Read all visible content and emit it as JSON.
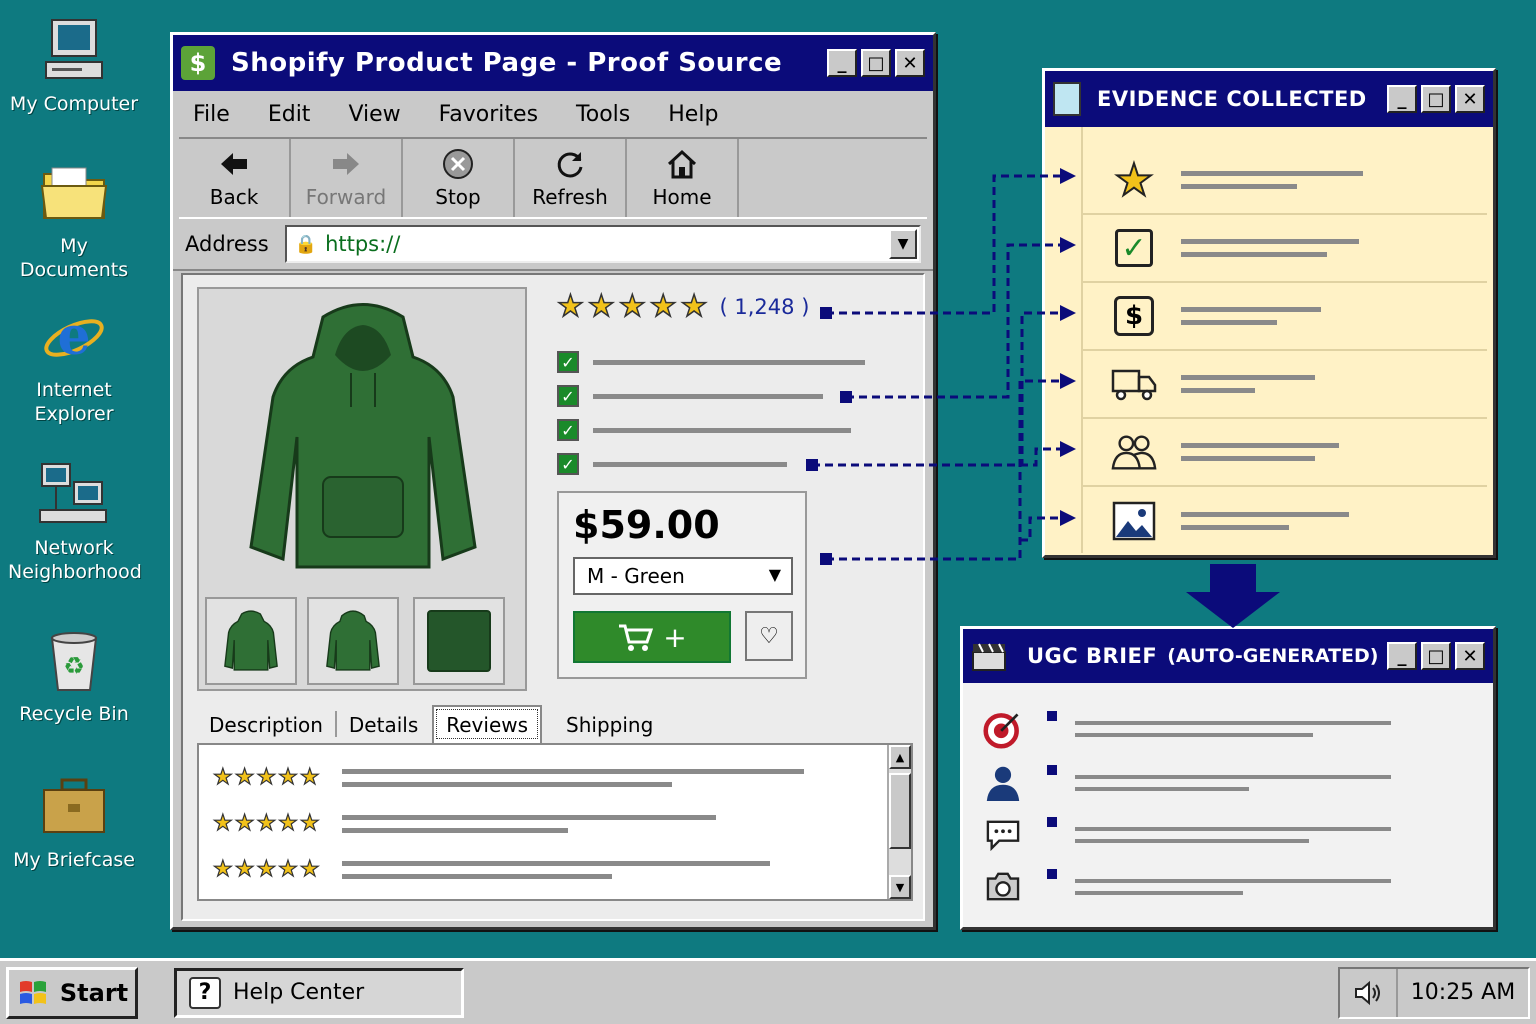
{
  "desktop": {
    "icons": [
      {
        "label": "My Computer"
      },
      {
        "label": "My Documents"
      },
      {
        "label": "Internet Explorer"
      },
      {
        "label": "Network Neighborhood"
      },
      {
        "label": "Recycle Bin"
      },
      {
        "label": "My Briefcase"
      }
    ]
  },
  "browser": {
    "title": "Shopify Product Page - Proof Source",
    "app_icon": "shopify-bag-icon",
    "menu": [
      "File",
      "Edit",
      "View",
      "Favorites",
      "Tools",
      "Help"
    ],
    "toolbar": {
      "back": "Back",
      "forward": "Forward",
      "stop": "Stop",
      "refresh": "Refresh",
      "home": "Home"
    },
    "address": {
      "label": "Address",
      "value": "https://"
    },
    "product": {
      "rating_stars": 5,
      "review_count": "( 1,248 )",
      "feature_checks": 4,
      "price": "$59.00",
      "variant": "M - Green",
      "add_to_cart_symbol": "+",
      "color": "#2f6f35"
    },
    "tabs": [
      "Description",
      "Details",
      "Reviews",
      "Shipping"
    ],
    "active_tab": "Reviews",
    "reviews": [
      {
        "stars": "★★★★★"
      },
      {
        "stars": "★★★★★"
      },
      {
        "stars": "★★★★★"
      }
    ]
  },
  "evidence": {
    "title": "EVIDENCE COLLECTED",
    "rows": [
      "star-icon",
      "checkbox-icon",
      "dollar-icon",
      "truck-icon",
      "people-icon",
      "image-icon"
    ]
  },
  "brief": {
    "title": "UGC BRIEF",
    "subtitle": "(AUTO-GENERATED)",
    "rows": [
      "target-icon",
      "person-icon",
      "chat-icon",
      "camera-icon"
    ]
  },
  "taskbar": {
    "start": "Start",
    "task": "Help Center",
    "clock": "10:25 AM"
  },
  "colors": {
    "desktop": "#0e7a80",
    "titlebar": "#0b0b7a",
    "evidence_bg": "#fff2c6",
    "cart_green": "#2f8a2a"
  }
}
